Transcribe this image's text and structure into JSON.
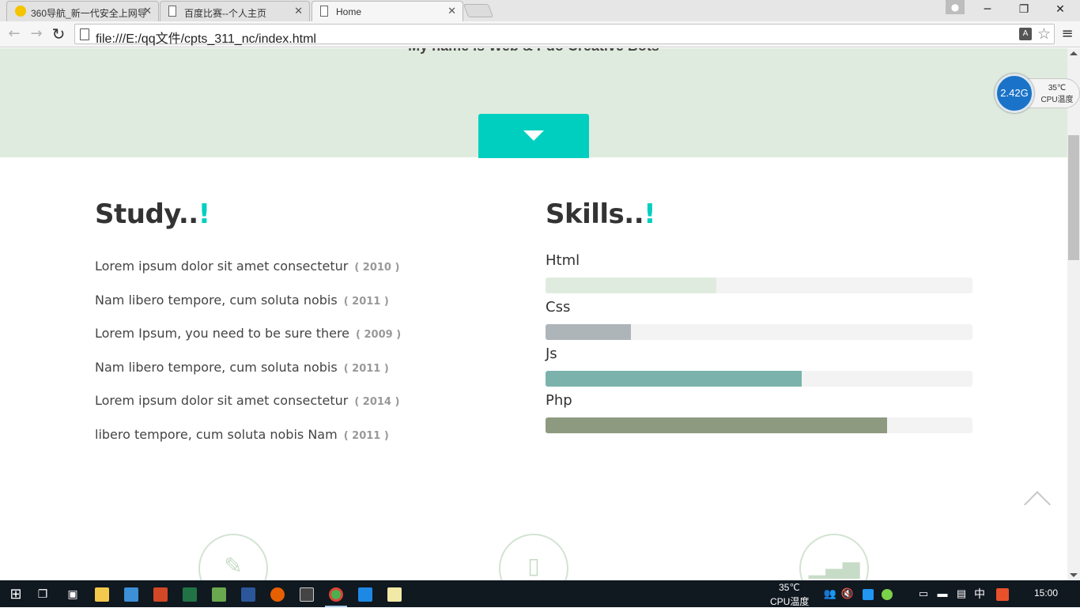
{
  "browser": {
    "tabs": [
      {
        "title": "360导航_新一代安全上网导",
        "active": false
      },
      {
        "title": "百度比赛--个人主页",
        "active": false
      },
      {
        "title": "Home",
        "active": true
      }
    ],
    "url": "file:///E:/qq文件/cpts_311_nc/index.html",
    "window_controls": {
      "minimize": "─",
      "restore": "❐",
      "close": "✕"
    }
  },
  "hero": {
    "subtitle": "My name is Web & Pdo Creative Bots",
    "background": "#dfebde",
    "accent": "#00cfbf"
  },
  "study": {
    "title": "Study..",
    "title_mark": "!",
    "items": [
      {
        "text": "Lorem ipsum dolor sit amet consectetur",
        "year": "( 2010 )"
      },
      {
        "text": "Nam libero tempore, cum soluta nobis",
        "year": "( 2011 )"
      },
      {
        "text": "Lorem Ipsum, you need to be sure there",
        "year": "( 2009 )"
      },
      {
        "text": "Nam libero tempore, cum soluta nobis",
        "year": "( 2011 )"
      },
      {
        "text": "Lorem ipsum dolor sit amet consectetur",
        "year": "( 2014 )"
      },
      {
        "text": "libero tempore, cum soluta nobis Nam",
        "year": "( 2011 )"
      }
    ]
  },
  "skills": {
    "title": "Skills..",
    "title_mark": "!",
    "items": [
      {
        "label": "Html",
        "level": 0.4,
        "color": "#dfebde"
      },
      {
        "label": "Css",
        "level": 0.2,
        "color": "#aeb5b8"
      },
      {
        "label": "Js",
        "level": 0.6,
        "color": "#7bb3ac"
      },
      {
        "label": "Php",
        "level": 0.8,
        "color": "#8d9a80"
      }
    ]
  },
  "features": {
    "icons": [
      "pencil-icon",
      "mobile-icon",
      "signal-icon"
    ]
  },
  "cpu_widget": {
    "freq": "2.42G",
    "temp": "35℃",
    "label": "CPU温度"
  },
  "taskbar": {
    "temp": "35℃",
    "temp_label": "CPU温度",
    "ime": "中",
    "clock": "15:00"
  }
}
